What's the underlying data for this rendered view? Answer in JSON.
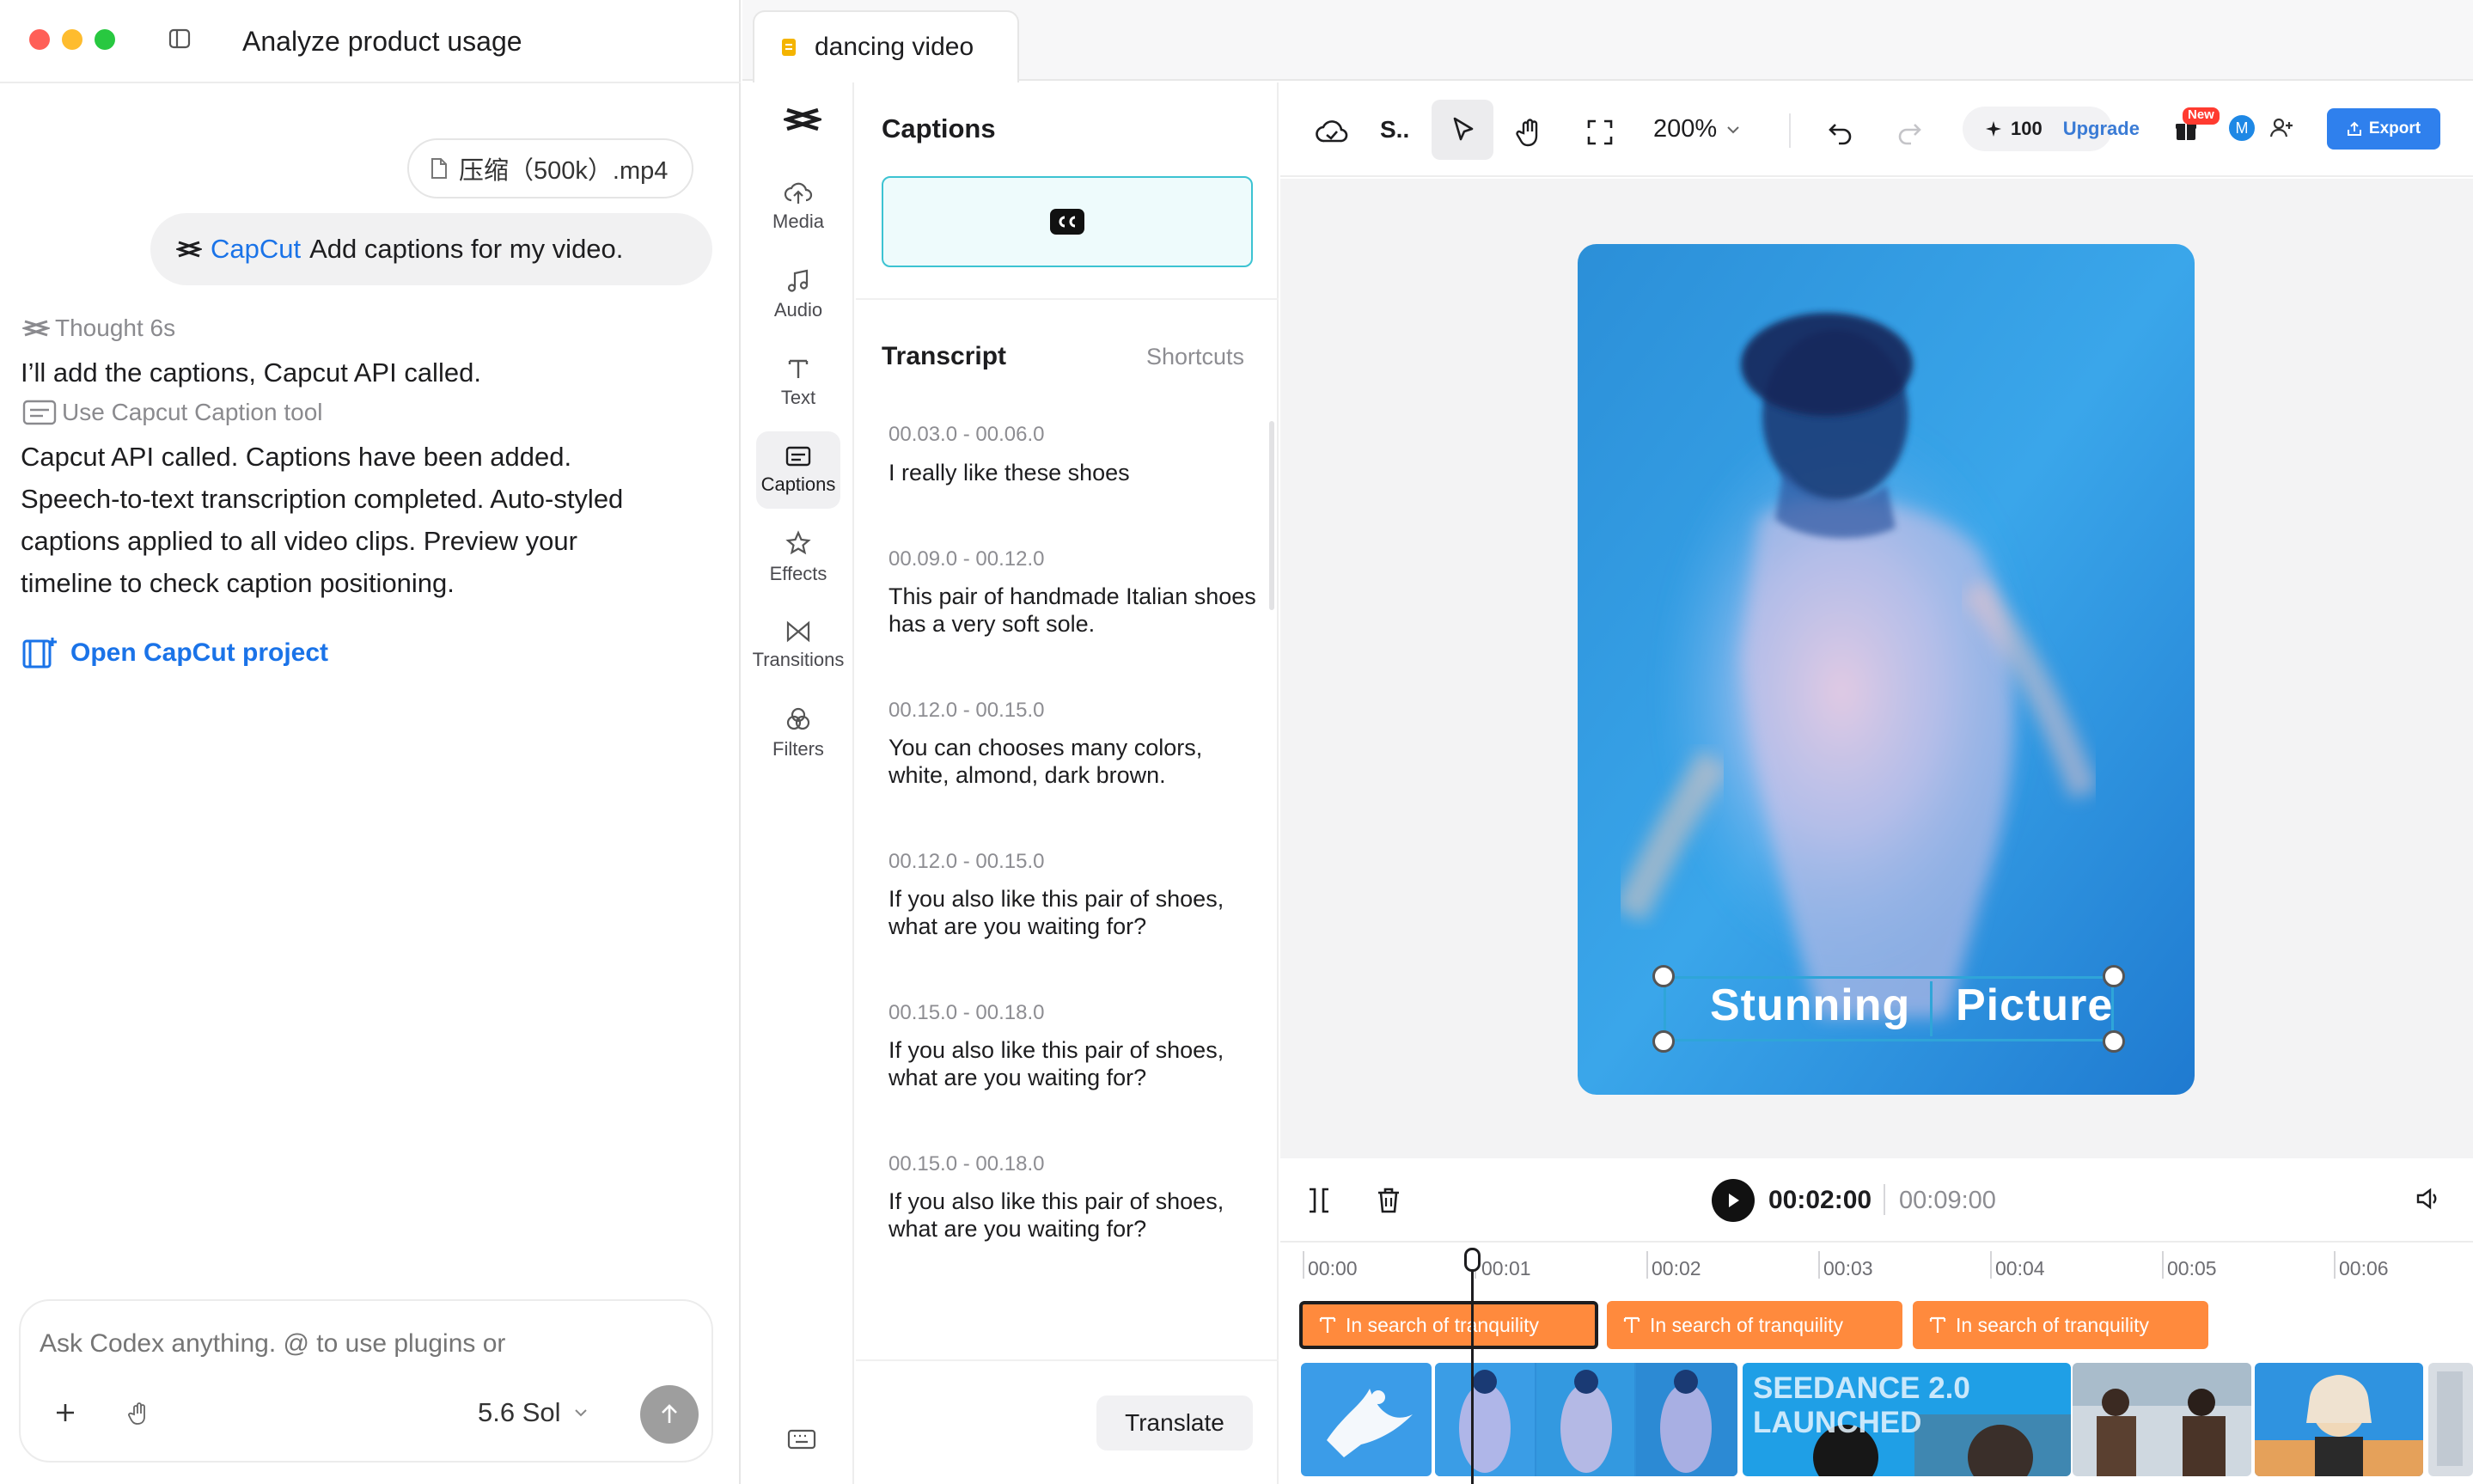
{
  "window": {
    "title": "Analyze product usage"
  },
  "chat": {
    "attachment": "压缩（500k）.mp4",
    "user_message": {
      "brand": "CapCut",
      "text": "Add captions for my video."
    },
    "thought": "Thought 6s",
    "line1": "I’ll add the  captions, Capcut API called.",
    "tool_used": "Use Capcut Caption tool",
    "result_lines": [
      "Capcut API called. Captions have been added.",
      "Speech-to-text transcription completed. Auto-styled",
      "captions applied to all video clips. Preview your",
      "timeline to check caption positioning."
    ],
    "open_link": "Open CapCut project",
    "composer_placeholder": "Ask Codex anything. @ to use plugins or",
    "model": "5.6 Sol"
  },
  "app": {
    "tab_title": "dancing video",
    "rail": [
      "Media",
      "Audio",
      "Text",
      "Captions",
      "Effects",
      "Transitions",
      "Filters"
    ],
    "panel_title": "Captions",
    "transcript_title": "Transcript",
    "shortcuts": "Shortcuts",
    "segments": [
      {
        "time": "00.03.0  -  00.06.0",
        "text": "I really like these shoes"
      },
      {
        "time": "00.09.0  -  00.12.0",
        "text": "This pair of handmade Italian shoes has a very soft sole."
      },
      {
        "time": "00.12.0  -  00.15.0",
        "text": "You can chooses many colors, white, almond, dark brown."
      },
      {
        "time": "00.12.0  -  00.15.0",
        "text": "If you also like this pair of shoes, what are you waiting for?"
      },
      {
        "time": "00.15.0  -  00.18.0",
        "text": "If you also like this pair of shoes, what are you waiting for?"
      },
      {
        "time": "00.15.0  -  00.18.0",
        "text": "If you also like this pair of shoes, what are you waiting for?"
      }
    ],
    "translate": "Translate",
    "toolbar": {
      "project_short": "S..",
      "zoom": "200%",
      "credits": "100",
      "upgrade": "Upgrade",
      "new_badge": "New",
      "avatar": "M",
      "export": "Export"
    },
    "preview_caption": {
      "word1": "Stunning",
      "word2": "Picture"
    },
    "timeline": {
      "current": "00:02:00",
      "total": "00:09:00",
      "ticks": [
        "00:00",
        "00:01",
        "00:02",
        "00:03",
        "00:04",
        "00:05",
        "00:06"
      ],
      "caption_clips": [
        "In search of tranquility",
        "In search of tranquility",
        "In search of tranquility"
      ],
      "thumb_text": "SEEDANCE 2.0 LAUNCHED"
    },
    "colors": {
      "accent": "#1a73e8",
      "caption_clip": "#ff8a3d",
      "selection": "#2fa5d8",
      "export": "#2f80ed"
    }
  }
}
